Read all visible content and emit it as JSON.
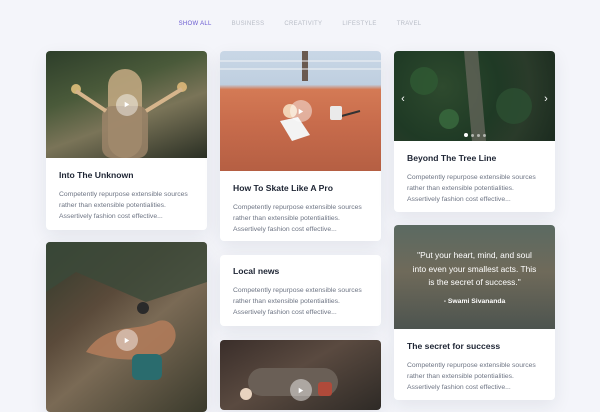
{
  "tabs": [
    {
      "label": "SHOW ALL",
      "active": true
    },
    {
      "label": "BUSINESS"
    },
    {
      "label": "CREATIVITY"
    },
    {
      "label": "LIFESTYLE"
    },
    {
      "label": "TRAVEL"
    }
  ],
  "cards": {
    "unknown": {
      "title": "Into The Unknown",
      "text": "Competently repurpose extensible sources rather than extensible potentialities. Assertively fashion cost effective..."
    },
    "skate": {
      "title": "How To Skate Like A Pro",
      "text": "Competently repurpose extensible sources rather than extensible potentialities. Assertively fashion cost effective..."
    },
    "tree": {
      "title": "Beyond The Tree Line",
      "text": "Competently repurpose extensible sources rather than extensible potentialities. Assertively fashion cost effective..."
    },
    "local": {
      "title": "Local news",
      "text": "Competently repurpose extensible sources rather than extensible potentialities. Assertively fashion cost effective..."
    },
    "secret": {
      "title": "The secret for success",
      "quote": "\"Put your heart, mind, and soul into even your smallest acts. This is the secret of success.\"",
      "author": "- Swami Sivananda",
      "text": "Competently repurpose extensible sources rather than extensible potentialities. Assertively fashion cost effective..."
    }
  },
  "icons": {
    "play": "play-icon",
    "prev": "chevron-left-icon",
    "next": "chevron-right-icon"
  },
  "colors": {
    "accent": "#6a5ad1",
    "background": "#f4f5fa"
  }
}
